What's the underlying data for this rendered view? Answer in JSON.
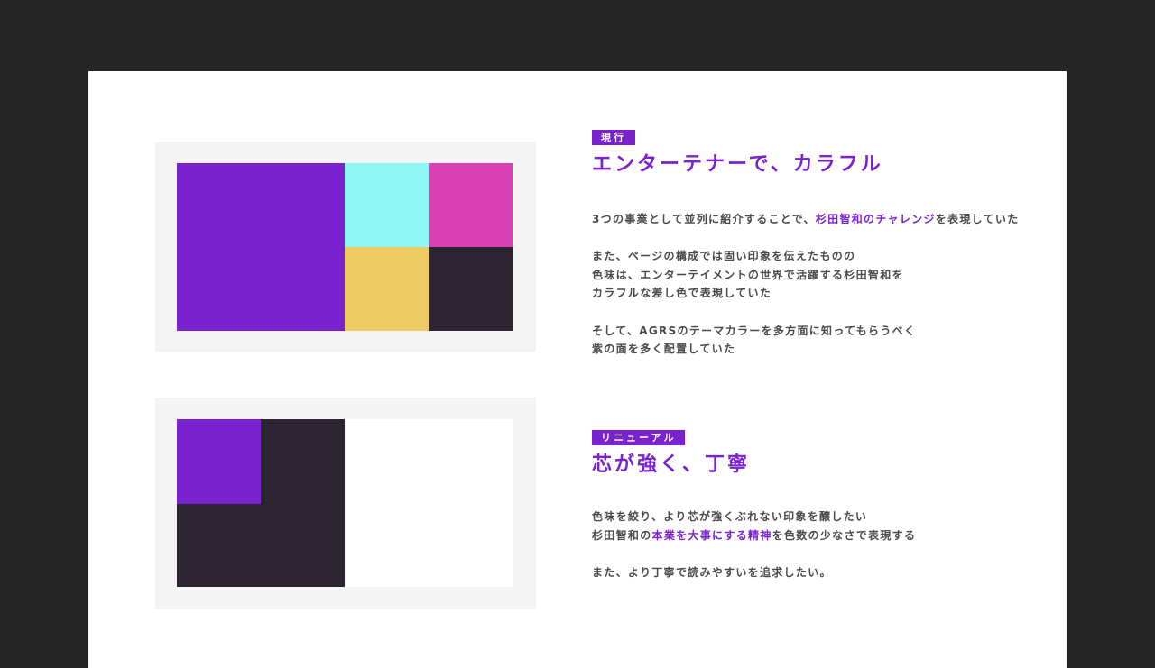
{
  "colors": {
    "background": "#262626",
    "card": "#ffffff",
    "frame": "#f4f4f4",
    "accent": "#7a22cf",
    "body_text": "#4a4a4a"
  },
  "sections": [
    {
      "tag": "現行",
      "heading": "エンターテナーで、カラフル",
      "palette": [
        {
          "name": "purple",
          "color": "#7a22cf"
        },
        {
          "name": "cyan",
          "color": "#8ff8f5"
        },
        {
          "name": "magenta",
          "color": "#d941b3"
        },
        {
          "name": "yellow",
          "color": "#eccb65"
        },
        {
          "name": "dark",
          "color": "#2c2431"
        }
      ],
      "body": {
        "p1": {
          "pre": "3つの事業として並列に紹介することで、",
          "hl": "杉田智和のチャレンジ",
          "post": "を表現していた"
        },
        "p2": [
          "また、ページの構成では固い印象を伝えたものの",
          "色味は、エンターテイメントの世界で活躍する杉田智和を",
          "カラフルな差し色で表現していた"
        ],
        "p3": [
          "そして、AGRSのテーマカラーを多方面に知ってもらうべく",
          "紫の面を多く配置していた"
        ]
      }
    },
    {
      "tag": "リニューアル",
      "heading": "芯が強く、丁寧",
      "palette": [
        {
          "name": "purple",
          "color": "#7a22cf"
        },
        {
          "name": "dark",
          "color": "#2c2431"
        },
        {
          "name": "white",
          "color": "#ffffff"
        }
      ],
      "body": {
        "p1": "色味を絞り、より芯が強くぶれない印象を醸したい",
        "p2": {
          "pre": "杉田智和の",
          "hl": "本業を大事にする精神",
          "post": "を色数の少なさで表現する"
        },
        "p3": "また、より丁寧で読みやすいを追求したい。"
      }
    }
  ]
}
